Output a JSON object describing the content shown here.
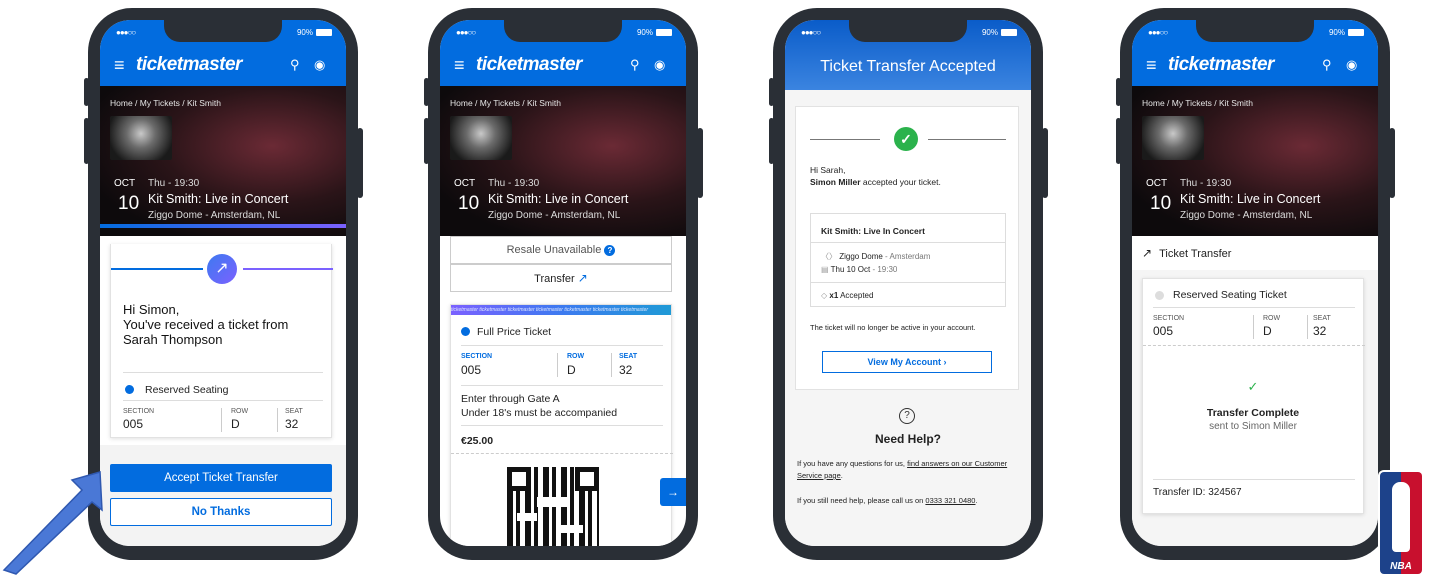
{
  "common": {
    "brand": "ticketmaster",
    "battery": "90%",
    "signal": "●●●○○",
    "breadcrumb": "Home  /  My Tickets  /  Kit Smith",
    "month": "OCT",
    "day": "10",
    "time": "Thu - 19:30",
    "event": "Kit Smith: Live in Concert",
    "venue": "Ziggo Dome - Amsterdam, NL"
  },
  "screen1": {
    "greeting": "Hi Simon,",
    "message": "You've received a ticket from Sarah Thompson",
    "ticket_type": "Reserved Seating",
    "section_label": "SECTION",
    "section": "005",
    "row_label": "ROW",
    "row": "D",
    "seat_label": "SEAT",
    "seat": "32",
    "accept_label": "Accept Ticket Transfer",
    "decline_label": "No Thanks"
  },
  "screen2": {
    "resale_label": "Resale Unavailable",
    "transfer_label": "Transfer",
    "ticket_type": "Full Price Ticket",
    "section_label": "SECTION",
    "section": "005",
    "row_label": "ROW",
    "row": "D",
    "seat_label": "SEAT",
    "seat": "32",
    "gate_info": "Enter through Gate A",
    "age_info": "Under 18's must be accompanied",
    "price": "€25.00",
    "strip_text": "ticketmaster ticketmaster ticketmaster ticketmaster ticketmaster ticketmaster ticketmaster"
  },
  "screen3": {
    "header": "Ticket Transfer Accepted",
    "hi": "Hi Sarah,",
    "accepter": "Simon Miller",
    "accepted_text": "accepted your ticket.",
    "event": "Kit Smith: Live In Concert",
    "venue_name": "Ziggo Dome",
    "venue_city": "- Amsterdam",
    "date": "Thu 10 Oct",
    "date_time": "- 19:30",
    "accepted_count": "x1",
    "accepted_word": "Accepted",
    "inactive_note": "The ticket will no longer be active in your account.",
    "view_account_label": "View My Account",
    "help_title": "Need Help?",
    "help_text_1": "If you have any questions for us,",
    "help_link": "find answers on our Customer Service page",
    "help_text_2": "If you still need help, please call us on",
    "phone": "0333 321 0480"
  },
  "screen4": {
    "transfer_heading": "Ticket Transfer",
    "ticket_type": "Reserved Seating Ticket",
    "section_label": "SECTION",
    "section": "005",
    "row_label": "ROW",
    "row": "D",
    "seat_label": "SEAT",
    "seat": "32",
    "complete_title": "Transfer Complete",
    "complete_sub": "sent to Simon Miller",
    "transfer_id": "Transfer ID: 324567"
  },
  "colors": {
    "brand_blue": "#026cdf",
    "success_green": "#2bb24c",
    "purple_accent": "#7b61ff",
    "arrow_blue": "#4a78d6"
  },
  "icons": [
    "menu-icon",
    "search-icon",
    "account-icon",
    "transfer-arrow-icon",
    "checkmark-icon",
    "info-icon",
    "help-icon",
    "next-arrow-icon"
  ]
}
